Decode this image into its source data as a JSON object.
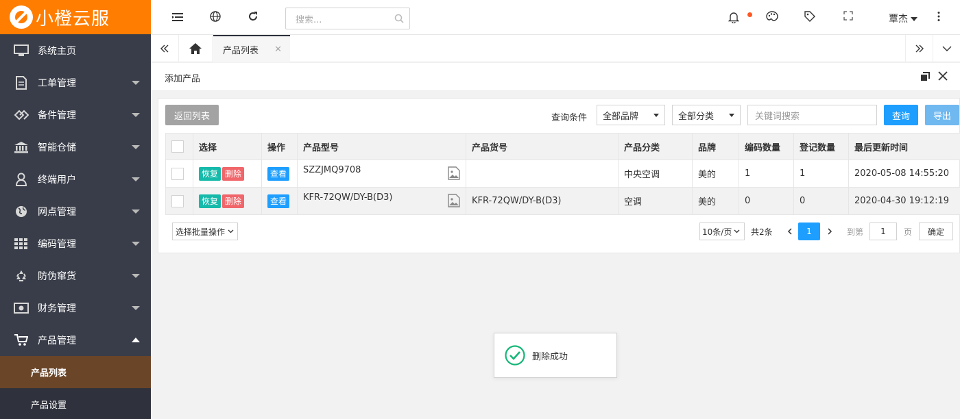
{
  "brand": {
    "name": "小橙云服",
    "color": "#ff7d00"
  },
  "sidebar": {
    "items": [
      {
        "label": "系统主页",
        "icon": "monitor-icon",
        "arrow": "none"
      },
      {
        "label": "工单管理",
        "icon": "document-icon",
        "arrow": "down"
      },
      {
        "label": "备件管理",
        "icon": "parts-icon",
        "arrow": "down"
      },
      {
        "label": "智能仓储",
        "icon": "bank-icon",
        "arrow": "down"
      },
      {
        "label": "终端用户",
        "icon": "user-icon",
        "arrow": "down"
      },
      {
        "label": "网点管理",
        "icon": "globe-icon",
        "arrow": "down"
      },
      {
        "label": "编码管理",
        "icon": "grid-icon",
        "arrow": "down"
      },
      {
        "label": "防伪窜货",
        "icon": "recycle-icon",
        "arrow": "down"
      },
      {
        "label": "财务管理",
        "icon": "money-icon",
        "arrow": "down"
      },
      {
        "label": "产品管理",
        "icon": "cart-icon",
        "arrow": "up"
      }
    ],
    "sub_items": [
      {
        "label": "产品列表",
        "active": true
      },
      {
        "label": "产品设置",
        "active": false
      }
    ]
  },
  "header": {
    "search_placeholder": "搜索...",
    "user_name": "覃杰",
    "notification_dot_color": "#ff5722"
  },
  "tabs": {
    "active_label": "产品列表"
  },
  "page": {
    "title": "添加产品"
  },
  "toolbar": {
    "back_label": "返回列表",
    "query_label": "查询条件",
    "brand_select": "全部品牌",
    "category_select": "全部分类",
    "keyword_placeholder": "关键词搜索",
    "search_button": "查询",
    "export_button": "导出"
  },
  "table": {
    "headers": [
      "选择",
      "操作",
      "产品型号",
      "产品货号",
      "产品分类",
      "品牌",
      "编码数量",
      "登记数量",
      "最后更新时间"
    ],
    "action_labels": {
      "restore": "恢复",
      "delete": "删除",
      "view": "查看"
    },
    "rows": [
      {
        "model": "SZZJMQ9708",
        "sku": "",
        "category": "中央空调",
        "brand": "美的",
        "code_count": "1",
        "reg_count": "1",
        "updated": "2020-05-08 14:55:20"
      },
      {
        "model": "KFR-72QW/DY-B(D3)",
        "sku": "KFR-72QW/DY-B(D3)",
        "category": "空调",
        "brand": "美的",
        "code_count": "0",
        "reg_count": "0",
        "updated": "2020-04-30 19:12:19"
      }
    ]
  },
  "footer": {
    "batch_label": "选择批量操作",
    "page_size": "10条/页",
    "total": "共2条",
    "current_page": "1",
    "goto_label": "到第",
    "goto_value": "1",
    "page_unit": "页",
    "confirm": "确定"
  },
  "toast": {
    "message": "删除成功",
    "color": "#16b777"
  }
}
